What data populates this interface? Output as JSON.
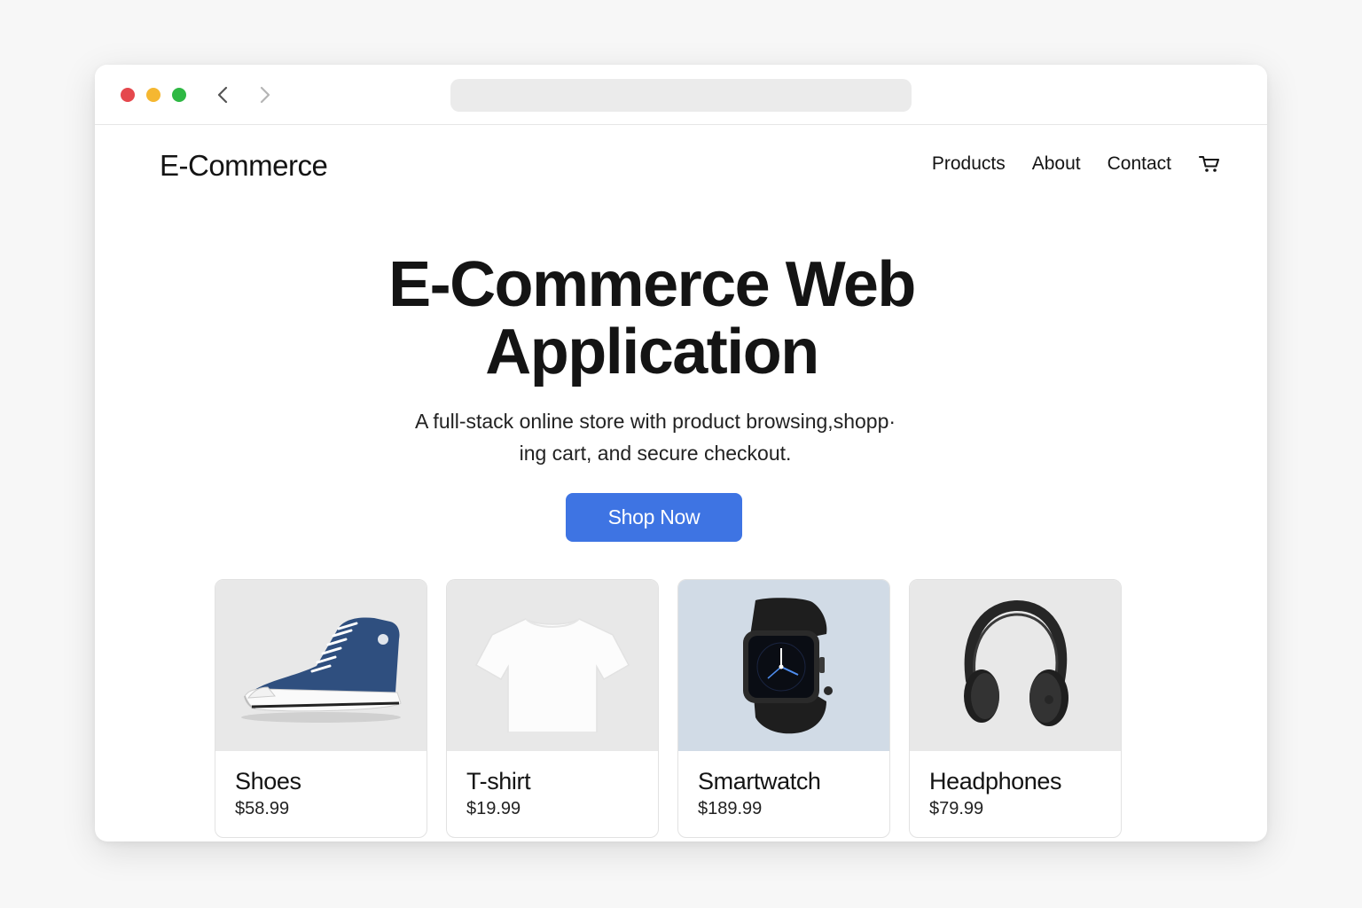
{
  "browser": {
    "traffic_lights": {
      "close": "#e5484d",
      "minimize": "#f5b731",
      "maximize": "#2fb844"
    },
    "address": ""
  },
  "header": {
    "brand": "E-Commerce",
    "nav": [
      {
        "label": "Products"
      },
      {
        "label": "About"
      },
      {
        "label": "Contact"
      }
    ],
    "cart_icon": "cart-icon"
  },
  "hero": {
    "title_line1": "E-Commerce Web",
    "title_line2": "Application",
    "subtitle_line1": "A full-stack online store with product browsing,shopp·",
    "subtitle_line2": "ing cart, and secure checkout.",
    "cta": "Shop Now",
    "cta_color": "#3e74e3"
  },
  "products": [
    {
      "name": "Shoes",
      "price": "$58.99",
      "image": "sneaker-image",
      "bg": "#e8e8e8"
    },
    {
      "name": "T-shirt",
      "price": "$19.99",
      "image": "tshirt-image",
      "bg": "#e8e8e8"
    },
    {
      "name": "Smartwatch",
      "price": "$189.99",
      "image": "smartwatch-image",
      "bg": "#d1dbe6"
    },
    {
      "name": "Headphones",
      "price": "$79.99",
      "image": "headphones-image",
      "bg": "#e8e8e8"
    }
  ]
}
